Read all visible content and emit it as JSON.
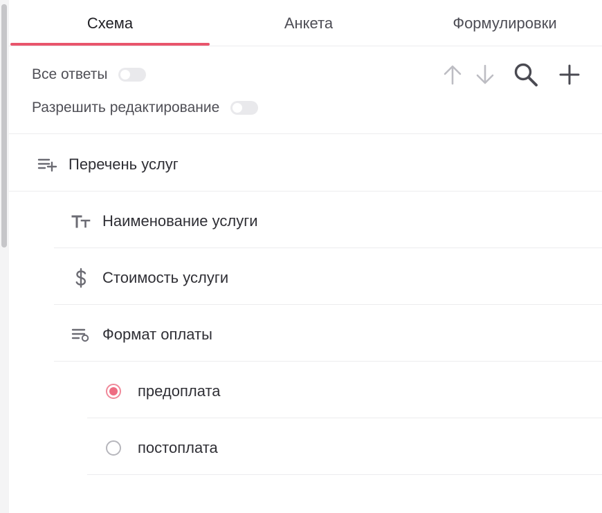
{
  "tabs": [
    {
      "label": "Схема",
      "active": true
    },
    {
      "label": "Анкета",
      "active": false
    },
    {
      "label": "Формулировки",
      "active": false
    }
  ],
  "toggles": {
    "all_answers": {
      "label": "Все ответы",
      "on": false
    },
    "allow_edit": {
      "label": "Разрешить редактирование",
      "on": false
    }
  },
  "toolbar": {
    "icons": [
      "arrow-up-icon",
      "arrow-down-icon",
      "search-icon",
      "plus-icon"
    ]
  },
  "tree": {
    "root": {
      "label": "Перечень услуг",
      "icon": "list-add-icon"
    },
    "fields": [
      {
        "label": "Наименование услуги",
        "icon": "text-type-icon"
      },
      {
        "label": "Стоимость услуги",
        "icon": "dollar-icon"
      },
      {
        "label": "Формат оплаты",
        "icon": "choice-list-icon"
      }
    ],
    "options": [
      {
        "label": "предоплата",
        "selected": true
      },
      {
        "label": "постоплата",
        "selected": false
      }
    ]
  },
  "colors": {
    "accent": "#e8556c",
    "radio_selected": "#ee6c82",
    "text_primary": "#2f2f35",
    "icon_muted": "#6b6b73",
    "arrow_disabled": "#bdbdc3"
  }
}
